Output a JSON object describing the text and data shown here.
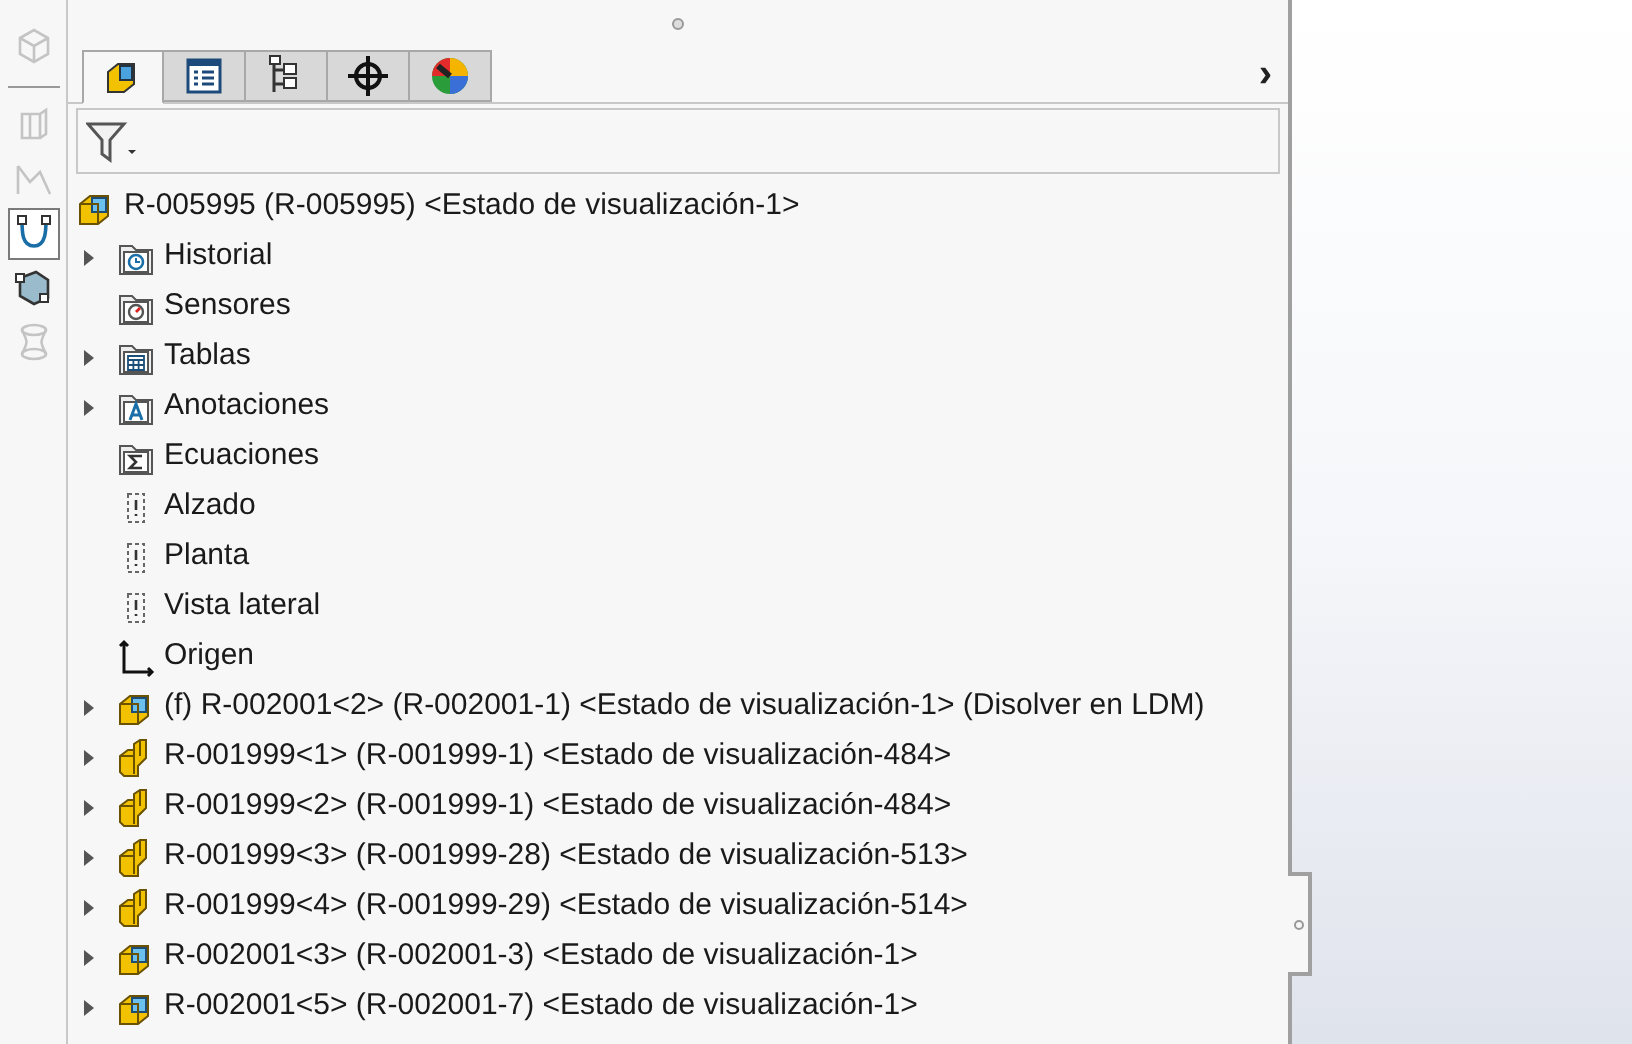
{
  "side_toolbar": [
    {
      "kind": "box",
      "selected": false,
      "disabled": true
    },
    {
      "kind": "extrude",
      "selected": false,
      "disabled": true
    },
    {
      "kind": "sketch",
      "selected": false,
      "disabled": true
    },
    {
      "kind": "curve",
      "selected": true,
      "disabled": false
    },
    {
      "kind": "solid",
      "selected": false,
      "disabled": false
    },
    {
      "kind": "loft",
      "selected": false,
      "disabled": true
    }
  ],
  "tabs": [
    {
      "kind": "feature",
      "selected": true
    },
    {
      "kind": "property",
      "selected": false
    },
    {
      "kind": "config",
      "selected": false
    },
    {
      "kind": "target",
      "selected": false
    },
    {
      "kind": "display",
      "selected": false
    }
  ],
  "tabs_more": "›",
  "tree": {
    "label": "R-005995 (R-005995) <Estado de visualización-1>",
    "kind": "assembly",
    "children": [
      {
        "label": "Historial",
        "kind": "history",
        "expander": true
      },
      {
        "label": "Sensores",
        "kind": "sensor",
        "expander": false
      },
      {
        "label": "Tablas",
        "kind": "table",
        "expander": true
      },
      {
        "label": "Anotaciones",
        "kind": "annotation",
        "expander": true
      },
      {
        "label": "Ecuaciones",
        "kind": "equation",
        "expander": false
      },
      {
        "label": "Alzado",
        "kind": "plane",
        "expander": false
      },
      {
        "label": "Planta",
        "kind": "plane",
        "expander": false
      },
      {
        "label": "Vista lateral",
        "kind": "plane",
        "expander": false
      },
      {
        "label": "Origen",
        "kind": "origin",
        "expander": false
      },
      {
        "label": "(f) R-002001<2> (R-002001-1) <Estado de visualización-1> (Disolver en LDM)",
        "kind": "assembly",
        "expander": true
      },
      {
        "label": "R-001999<1> (R-001999-1) <Estado de visualización-484>",
        "kind": "part",
        "expander": true
      },
      {
        "label": "R-001999<2> (R-001999-1) <Estado de visualización-484>",
        "kind": "part",
        "expander": true
      },
      {
        "label": "R-001999<3> (R-001999-28) <Estado de visualización-513>",
        "kind": "part",
        "expander": true
      },
      {
        "label": "R-001999<4> (R-001999-29) <Estado de visualización-514>",
        "kind": "part",
        "expander": true
      },
      {
        "label": "R-002001<3> (R-002001-3) <Estado de visualización-1>",
        "kind": "assembly",
        "expander": true
      },
      {
        "label": "R-002001<5> (R-002001-7) <Estado de visualización-1>",
        "kind": "assembly",
        "expander": true
      }
    ]
  }
}
